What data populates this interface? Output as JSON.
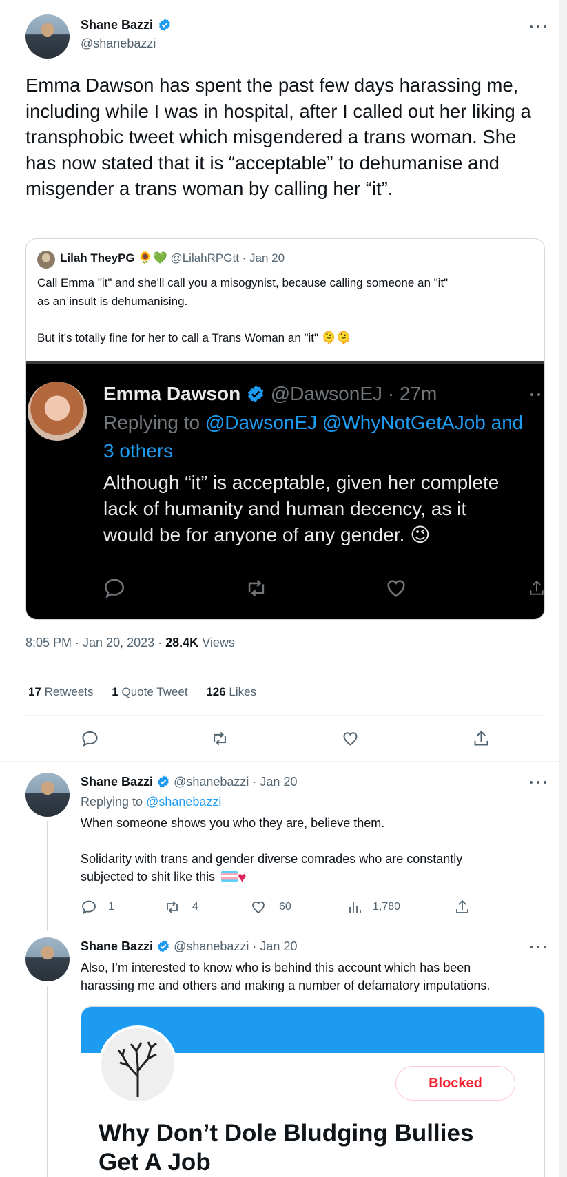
{
  "main_tweet": {
    "author_name": "Shane Bazzi",
    "author_handle": "@shanebazzi",
    "text": "Emma Dawson has spent the past few days harassing me, including while I was in hospital, after I called out her liking a transphobic tweet which misgendered a trans woman. She has now stated that it is “acceptable” to dehumanise and misgender a trans woman by calling her “it”.",
    "quoted": {
      "author_name": "Lilah TheyPG",
      "author_emoji": "🌻💚",
      "author_handle": "@LilahRPGtt",
      "date": "· Jan 20",
      "text_line1": "Call Emma \"it\" and she'll call you a misogynist, because calling someone an \"it\"",
      "text_line2": "as an insult is dehumanising.",
      "text_line3": "But it's totally fine for her to call a Trans Woman an \"it\" 🫠🫠",
      "screenshot": {
        "author_name": "Emma Dawson",
        "author_handle": "@DawsonEJ · 27m",
        "replying_prefix": "Replying to",
        "replying_to": "@DawsonEJ @WhyNotGetAJob and",
        "replying_to2": "3 others",
        "text_line1": "Although “it” is acceptable, given her complete",
        "text_line2": "lack of humanity and human decency, as it",
        "text_line3": "would be for anyone of any gender. 😉"
      }
    },
    "timestamp": "8:05 PM · Jan 20, 2023 ·",
    "views_count": "28.4K",
    "views_label": "Views",
    "retweets_count": "17",
    "retweets_label": "Retweets",
    "quotes_count": "1",
    "quotes_label": "Quote Tweet",
    "likes_count": "126",
    "likes_label": "Likes"
  },
  "reply1": {
    "author_name": "Shane Bazzi",
    "author_handle": "@shanebazzi",
    "date": "· Jan 20",
    "replying_prefix": "Replying to",
    "replying_to": "@shanebazzi",
    "text_line1": "When someone shows you who they are, believe them.",
    "text_line2": "Solidarity with trans and gender diverse comrades who are constantly",
    "text_line3": "subjected to shit like this",
    "reply_count": "1",
    "retweet_count": "4",
    "like_count": "60",
    "view_count": "1,780"
  },
  "reply2": {
    "author_name": "Shane Bazzi",
    "author_handle": "@shanebazzi",
    "date": "· Jan 20",
    "text_line1": "Also, I’m interested to know who is behind this account which has been",
    "text_line2": "harassing me and others and making a number of defamatory imputations.",
    "card": {
      "blocked_label": "Blocked",
      "profile_name_line1": "Why Don’t Dole Bludging Bullies",
      "profile_name_line2": "Get A Job"
    }
  },
  "colors": {
    "accent": "#1d9bf0",
    "muted": "#536471",
    "blocked": "#f4212e",
    "banner": "#1d9bf0"
  }
}
